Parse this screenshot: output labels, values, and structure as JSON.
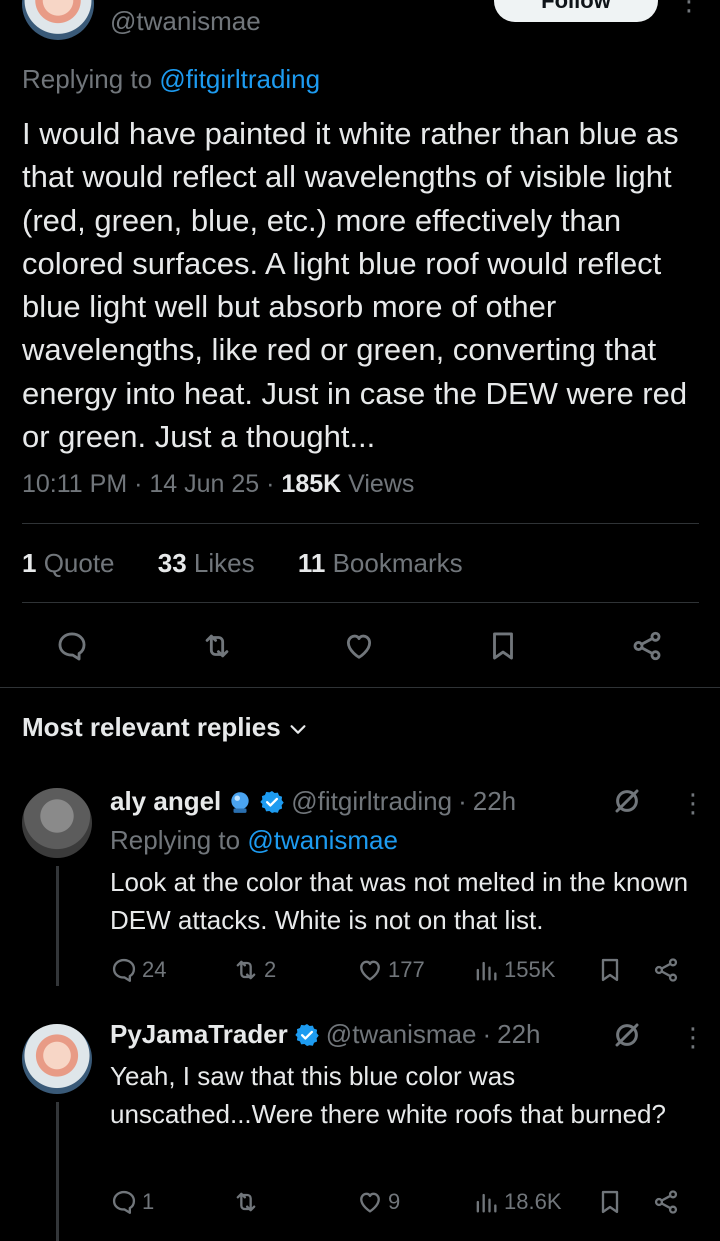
{
  "header": {
    "handle": "@twanismae",
    "follow_label": "Follow"
  },
  "tweet": {
    "replying_prefix": "Replying to ",
    "replying_to": "@fitgirltrading",
    "text": "I would have painted it white rather than blue as that would reflect all wavelengths of visible light (red, green, blue, etc.) more effectively than colored surfaces. A light blue roof would reflect blue light well but absorb more of other wavelengths, like red or green, converting that energy into heat. Just in case the DEW were red or green. Just a thought...",
    "time": "10:11 PM",
    "date": "14 Jun 25",
    "views_count": "185K",
    "views_label": " Views",
    "sep": " · "
  },
  "stats": {
    "quotes_count": "1",
    "quotes_label": " Quote",
    "likes_count": "33",
    "likes_label": " Likes",
    "bookmarks_count": "11",
    "bookmarks_label": " Bookmarks"
  },
  "actions": [
    "reply-icon",
    "retweet-icon",
    "like-icon",
    "bookmark-icon",
    "share-icon"
  ],
  "sort": {
    "label": "Most relevant replies"
  },
  "replies": [
    {
      "name": "aly angel",
      "handle": "@fitgirltrading",
      "time": "22h",
      "replying_prefix": "Replying to ",
      "replying_to": "@twanismae",
      "text": "Look at the color that was not melted in the known DEW attacks. White is not on that list.",
      "replies": "24",
      "reposts": "2",
      "likes": "177",
      "views": "155K"
    },
    {
      "name": "PyJamaTrader",
      "handle": "@twanismae",
      "time": "22h",
      "text": "Yeah, I saw that this blue color was unscathed...Were there white roofs that burned?",
      "replies": "1",
      "reposts": "",
      "likes": "9",
      "views": "18.6K"
    }
  ],
  "colors": {
    "background": "#000000",
    "text": "#e7e9ea",
    "secondary": "#71767b",
    "accent": "#1d9bf0",
    "divider": "#2f3336"
  }
}
